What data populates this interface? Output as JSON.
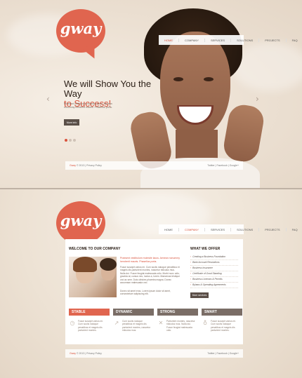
{
  "brand": {
    "logo_text": "gway",
    "accent": "#e0654f"
  },
  "nav": {
    "items": [
      {
        "label": "Home"
      },
      {
        "label": "Company"
      },
      {
        "label": "Services"
      },
      {
        "label": "Solutions"
      },
      {
        "label": "Projects"
      },
      {
        "label": "FAQ"
      }
    ],
    "home_active_index": 0,
    "inner_active_index": 1
  },
  "hero": {
    "title_line1": "We will Show You the Way",
    "title_line2": "to Success!",
    "subtitle": "Praesent vestibulum molestie lacus. Aenean nonummy hendrerit mauris. Phasellus porta.",
    "button": "More info",
    "prev_icon": "chevron-left-icon",
    "next_icon": "chevron-right-icon",
    "slides_total": 3,
    "slide_active": 1
  },
  "footer": {
    "brand": "Gway",
    "copyright": "© 2013 | Privacy Policy",
    "social": "Twitter | Facebook | Google+"
  },
  "welcome": {
    "title": "Welcome to Our Company",
    "intro": "Praesent vestibulum molestie lacus. Aenean nonummy hendrerit mauris. Phasellus porta.",
    "para1": "Fusce suscipit varius mi. Cum sociis natoque penatibus et magnis dis parturient montes, nascetur ridiculus mus. Nulla dui. Fusce feugiat malesuada odio. Morbi nunc odio, gravida at, cursus nec, luctus a, lorem. Maecenas tristique orci ac sem. Duis ultricies pharetra magna. Donec accumsan malesuada orci.",
    "para2": "Donec sit amet eros. Lorem ipsum dolor sit amet, consectetuer adipiscing elit."
  },
  "offer": {
    "title": "What We Offer",
    "items": [
      "Creating a Business Foundation",
      "Bank Account Resolutions",
      "Business Insurance",
      "Certificate of Good Standing",
      "Business Licenses & Permits",
      "Bylaws & Operating Agreements"
    ],
    "button": "More services"
  },
  "features": [
    {
      "title": "Stable",
      "color": "#e0654f",
      "icon": "clock-icon",
      "glyph": "◷",
      "text": "Fusce suscipit varius mi. Cum sociis natoque penatibus et magnis dis parturient montes."
    },
    {
      "title": "Dynamic",
      "color": "#7a6d66",
      "icon": "chart-icon",
      "glyph": "↗",
      "text": "Cum sociis natoque penatibus et magnis dis parturient montes, nascetur ridiculus mus."
    },
    {
      "title": "Strong",
      "color": "#7a6d66",
      "icon": "tools-icon",
      "glyph": "✕",
      "text": "Parturient montes, nascetur ridiculus mus. Nulla dui. Fusce feugiat malesuada odio."
    },
    {
      "title": "Smart",
      "color": "#7a6d66",
      "icon": "lightbulb-icon",
      "glyph": "♁",
      "text": "Fusce suscipit varius mi. Cum sociis natoque penatibus et magnis dis parturient montes."
    }
  ]
}
